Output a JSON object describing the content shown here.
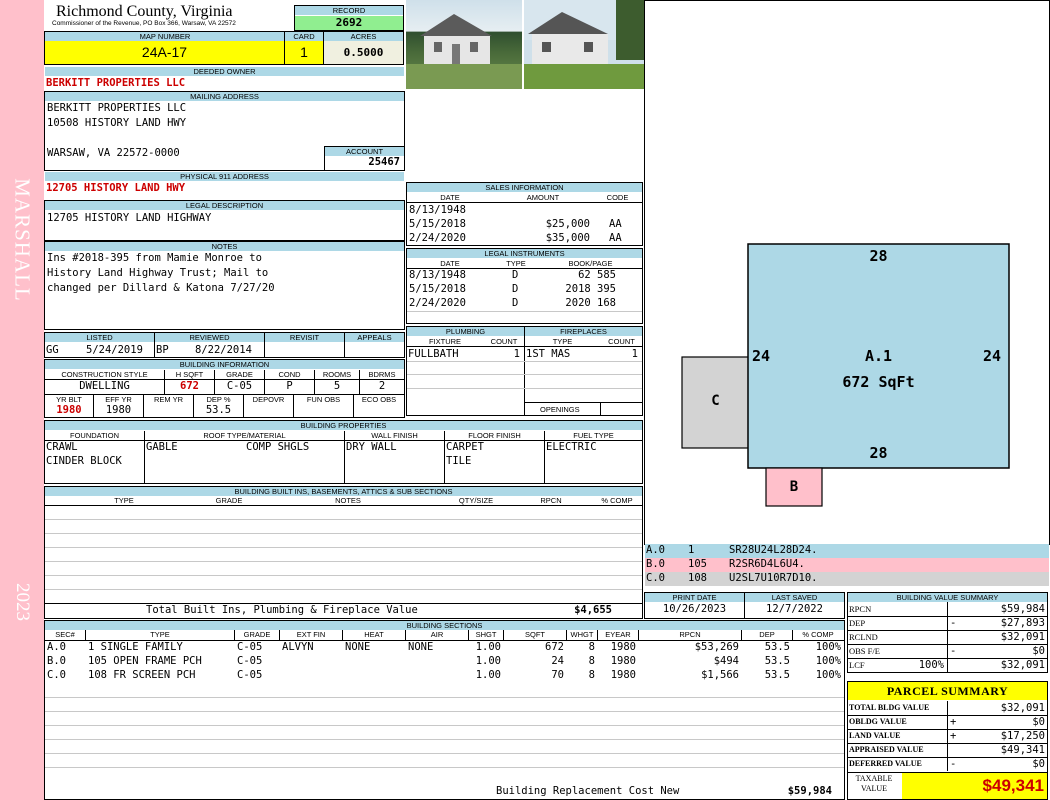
{
  "side": {
    "left_text": "MARSHALL",
    "year": "2023",
    "strip_color": "#ffc0cb"
  },
  "header": {
    "county": "Richmond County, Virginia",
    "commissioner": "Commissioner of the Revenue, PO Box 366, Warsaw, VA 22572",
    "record_label": "RECORD",
    "record": "2692",
    "map_label": "MAP NUMBER",
    "map_number": "24A-17",
    "card_label": "CARD",
    "card": "1",
    "acres_label": "ACRES",
    "acres": "0.5000"
  },
  "owner": {
    "label": "DEEDED OWNER",
    "name": "BERKITT PROPERTIES LLC"
  },
  "mailing": {
    "label": "MAILING ADDRESS",
    "line1": "BERKITT PROPERTIES LLC",
    "line2": "10508 HISTORY LAND HWY",
    "line3": "WARSAW, VA 22572-0000",
    "account_label": "ACCOUNT",
    "account": "25467"
  },
  "physical": {
    "label": "PHYSICAL 911 ADDRESS",
    "address": "12705 HISTORY LAND HWY"
  },
  "legal": {
    "label": "LEGAL DESCRIPTION",
    "text": "12705 HISTORY LAND HIGHWAY"
  },
  "notes": {
    "label": "NOTES",
    "line1": "Ins #2018-395 from Mamie Monroe to",
    "line2": "History Land Highway Trust; Mail to",
    "line3": "changed per Dillard & Katona 7/27/20"
  },
  "sales": {
    "label": "SALES INFORMATION",
    "h_date": "DATE",
    "h_amount": "AMOUNT",
    "h_code": "CODE",
    "rows": [
      {
        "date": "8/13/1948",
        "amount": "",
        "code": ""
      },
      {
        "date": "5/15/2018",
        "amount": "$25,000",
        "code": "AA"
      },
      {
        "date": "2/24/2020",
        "amount": "$35,000",
        "code": "AA"
      }
    ]
  },
  "instruments": {
    "label": "LEGAL INSTRUMENTS",
    "h_date": "DATE",
    "h_type": "TYPE",
    "h_book": "BOOK/PAGE",
    "rows": [
      {
        "date": "8/13/1948",
        "type": "D",
        "book": "62 585"
      },
      {
        "date": "5/15/2018",
        "type": "D",
        "book": "2018 395"
      },
      {
        "date": "2/24/2020",
        "type": "D",
        "book": "2020 168"
      }
    ]
  },
  "plumbing": {
    "label": "PLUMBING",
    "h_fixture": "FIXTURE",
    "h_count": "COUNT",
    "fixture": "FULLBATH",
    "count": "1"
  },
  "fireplaces": {
    "label": "FIREPLACES",
    "h_type": "TYPE",
    "h_count": "COUNT",
    "type": "1ST MAS",
    "count": "1",
    "openings_label": "OPENINGS"
  },
  "listed": {
    "h_listed": "LISTED",
    "h_reviewed": "REVIEWED",
    "h_revisit": "REVISIT",
    "h_appeals": "APPEALS",
    "listed_by": "GG",
    "listed_date": "5/24/2019",
    "reviewed_by": "BP",
    "reviewed_date": "8/22/2014"
  },
  "building_info": {
    "label": "BUILDING INFORMATION",
    "h_style": "CONSTRUCTION STYLE",
    "h_hsqft": "H SQFT",
    "h_grade": "GRADE",
    "h_cond": "COND",
    "h_rooms": "ROOMS",
    "h_bdrms": "BDRMS",
    "style": "DWELLING",
    "hsqft": "672",
    "grade": "C-05",
    "cond": "P",
    "rooms": "5",
    "bdrms": "2",
    "h_yrblt": "YR BLT",
    "h_effyr": "EFF YR",
    "h_remyr": "REM YR",
    "h_dep": "DEP %",
    "h_depovr": "DEPOVR",
    "h_funobs": "FUN OBS",
    "h_ecoobs": "ECO OBS",
    "yrblt": "1980",
    "effyr": "1980",
    "dep": "53.5"
  },
  "building_props": {
    "label": "BUILDING PROPERTIES",
    "h_foundation": "FOUNDATION",
    "h_roof": "ROOF TYPE/MATERIAL",
    "h_wall": "WALL FINISH",
    "h_floor": "FLOOR FINISH",
    "h_fuel": "FUEL TYPE",
    "foundation1": "CRAWL",
    "foundation2": "CINDER BLOCK",
    "roof_type": "GABLE",
    "roof_mat": "COMP SHGLS",
    "wall": "DRY WALL",
    "floor1": "CARPET",
    "floor2": "TILE",
    "fuel": "ELECTRIC"
  },
  "builtins": {
    "label": "BUILDING BUILT INS, BASEMENTS, ATTICS & SUB SECTIONS",
    "h_type": "TYPE",
    "h_grade": "GRADE",
    "h_notes": "NOTES",
    "h_qty": "QTY/SIZE",
    "h_rpcn": "RPCN",
    "h_comp": "% COMP",
    "total_label": "Total Built Ins, Plumbing & Fireplace Value",
    "total": "$4,655"
  },
  "sections": {
    "label": "BUILDING SECTIONS",
    "headers": [
      "SEC#",
      "TYPE",
      "GRADE",
      "EXT FIN",
      "HEAT",
      "AIR",
      "SHGT",
      "SQFT",
      "WHGT",
      "EYEAR",
      "RPCN",
      "DEP",
      "% COMP"
    ],
    "rows": [
      {
        "sec": "A.0",
        "type": "1 SINGLE FAMILY",
        "grade": "C-05",
        "ext": "ALVYN",
        "heat": "NONE",
        "air": "NONE",
        "shgt": "1.00",
        "sqft": "672",
        "whgt": "8",
        "eyear": "1980",
        "rpcn": "$53,269",
        "dep": "53.5",
        "comp": "100%"
      },
      {
        "sec": "B.0",
        "type": "105 OPEN FRAME PCH",
        "grade": "C-05",
        "ext": "",
        "heat": "",
        "air": "",
        "shgt": "1.00",
        "sqft": "24",
        "whgt": "8",
        "eyear": "1980",
        "rpcn": "$494",
        "dep": "53.5",
        "comp": "100%"
      },
      {
        "sec": "C.0",
        "type": "108 FR SCREEN PCH",
        "grade": "C-05",
        "ext": "",
        "heat": "",
        "air": "",
        "shgt": "1.00",
        "sqft": "70",
        "whgt": "8",
        "eyear": "1980",
        "rpcn": "$1,566",
        "dep": "53.5",
        "comp": "100%"
      }
    ],
    "replacement_label": "Building Replacement Cost New",
    "replacement": "$59,984"
  },
  "sketch": {
    "a_label": "A.1",
    "a_area": "672 SqFt",
    "top": "28",
    "bottom": "28",
    "left": "24",
    "right": "24",
    "b_label": "B",
    "c_label": "C",
    "color_a": "#add8e6",
    "color_b": "#ffc0cb",
    "color_c": "#d3d3d3",
    "legend": [
      {
        "sec": "A.0",
        "code": "1",
        "path": "SR28U24L28D24."
      },
      {
        "sec": "B.0",
        "code": "105",
        "path": "R2SR6D4L6U4."
      },
      {
        "sec": "C.0",
        "code": "108",
        "path": "U2SL7U10R7D10."
      }
    ]
  },
  "dates": {
    "h_print": "PRINT DATE",
    "h_saved": "LAST SAVED",
    "print": "10/26/2023",
    "saved": "12/7/2022"
  },
  "value_summary": {
    "label": "BUILDING VALUE SUMMARY",
    "rows": [
      {
        "label": "RPCN",
        "sign": "",
        "value": "$59,984"
      },
      {
        "label": "DEP",
        "sign": "-",
        "value": "$27,893"
      },
      {
        "label": "RCLND",
        "sign": "",
        "value": "$32,091"
      },
      {
        "label": "OBS F/E",
        "sign": "-",
        "value": "$0"
      },
      {
        "label": "LCF",
        "pct": "100%",
        "sign": "",
        "value": "$32,091"
      }
    ]
  },
  "parcel": {
    "label": "PARCEL SUMMARY",
    "rows": [
      {
        "label": "TOTAL BLDG VALUE",
        "sign": "",
        "value": "$32,091"
      },
      {
        "label": "OBLDG VALUE",
        "sign": "+",
        "value": "$0"
      },
      {
        "label": "LAND VALUE",
        "sign": "+",
        "value": "$17,250"
      },
      {
        "label": "APPRAISED VALUE",
        "sign": "",
        "value": "$49,341"
      },
      {
        "label": "DEFERRED VALUE",
        "sign": "-",
        "value": "$0"
      }
    ],
    "taxable_label1": "TAXABLE",
    "taxable_label2": "VALUE",
    "taxable": "$49,341"
  }
}
